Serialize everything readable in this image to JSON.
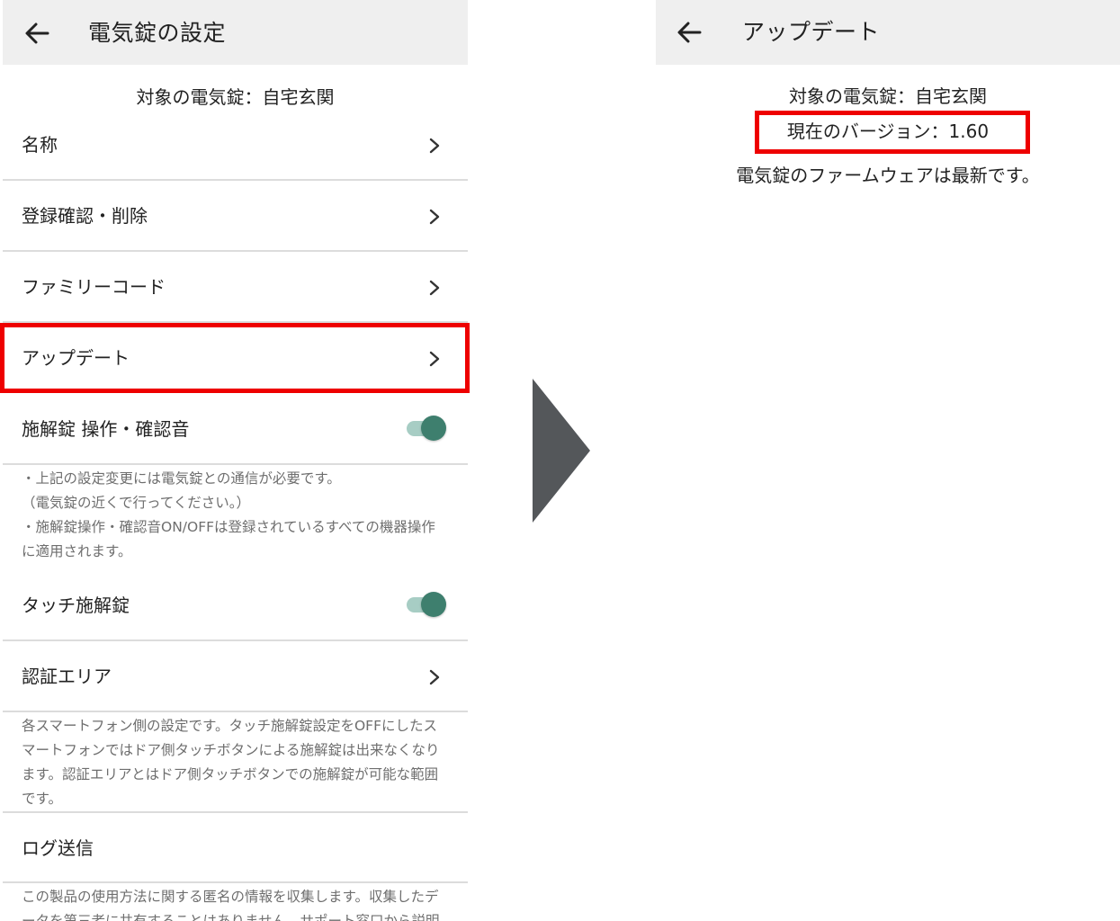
{
  "left_screen": {
    "header": {
      "title": "電気錠の設定",
      "back_icon": "arrow-left-icon"
    },
    "target_lock": "対象の電気錠：自宅玄関",
    "menu": {
      "name": "名称",
      "registration": "登録確認・削除",
      "family_code": "ファミリーコード",
      "update": "アップデート",
      "lock_sound": "施解錠 操作・確認音",
      "touch_lock": "タッチ施解錠",
      "auth_area": "認証エリア",
      "log_send": "ログ送信"
    },
    "toggles": {
      "lock_sound_on": true,
      "touch_lock_on": true
    },
    "notes": {
      "settings_lines": [
        "・上記の設定変更には電気錠との通信が必要です。",
        "（電気錠の近くで行ってください。）",
        "・施解錠操作・確認音ON/OFFは登録されているすべての機器操作",
        "に適用されます。"
      ],
      "touch_lines": [
        "各スマートフォン側の設定です。タッチ施解錠設定をOFFにしたス",
        "マートフォンではドア側タッチボタンによる施解錠は出来なくなり",
        "ます。認証エリアとはドア側タッチボタンでの施解錠が可能な範囲",
        "です。"
      ],
      "log_lines": [
        "この製品の使用方法に関する匿名の情報を収集します。収集したデ",
        "ータを第三者に共有することはありません。サポート窓口から説明"
      ]
    }
  },
  "right_screen": {
    "header": {
      "title": "アップデート",
      "back_icon": "arrow-left-icon"
    },
    "target_lock": "対象の電気錠：自宅玄関",
    "current_version": "現在のバージョン：1.60",
    "status": "電気錠のファームウェアは最新です。"
  },
  "colors": {
    "appbar_bg": "#efefef",
    "highlight": "#ee0000",
    "toggle_thumb": "#3e7f6e",
    "toggle_track": "#a7cdc4",
    "arrow": "#54575a",
    "divider": "#dcdcdc",
    "note_text": "#6e6e6e"
  }
}
